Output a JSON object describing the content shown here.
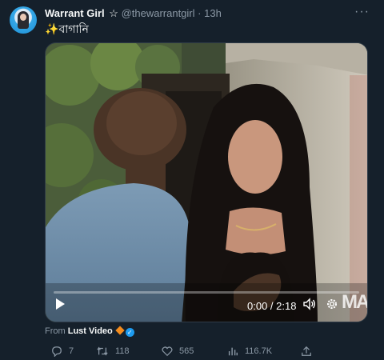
{
  "post": {
    "author_name": "Warrant Girl",
    "author_badge": "☆",
    "handle": "@thewarrantgirl",
    "separator": "·",
    "time": "13h",
    "more": "···",
    "sparkle": "✨",
    "text": "বাগানি"
  },
  "video": {
    "current_time": "0:00",
    "time_sep": " / ",
    "duration": "2:18",
    "progress_fraction": 0.0,
    "watermark": "MA"
  },
  "source": {
    "prefix": "From",
    "name": "Lust Video",
    "verified_mark": "✓"
  },
  "actions": {
    "replies": "7",
    "reposts": "118",
    "likes": "565",
    "views": "116.7K"
  },
  "colors": {
    "background": "#15202b",
    "muted": "#8b98a5",
    "accent": "#1d9bf0"
  },
  "icons": [
    "reply-icon",
    "repost-icon",
    "like-icon",
    "views-icon",
    "share-icon",
    "play-icon",
    "volume-icon",
    "settings-icon"
  ]
}
